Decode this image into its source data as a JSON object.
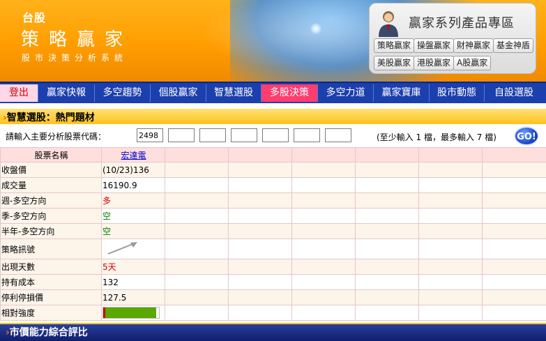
{
  "banner": {
    "tag": "台股",
    "title": "策略贏家",
    "subtitle": "股市決策分析系統",
    "promo_title": "贏家系列產品專區",
    "promo_buttons": [
      "策略贏家",
      "操盤贏家",
      "財神贏家",
      "基金神盾",
      "美股贏家",
      "港股贏家",
      "A股贏家"
    ]
  },
  "nav": {
    "items": [
      "登出",
      "贏家快報",
      "多空趨勢",
      "個股贏家",
      "智慧選股",
      "多股決策",
      "多空力道",
      "贏家寶庫",
      "股市動態",
      "自設選股"
    ],
    "active": "多股決策"
  },
  "section": {
    "title": "智慧選股：熱門題材"
  },
  "input": {
    "label": "請輸入主要分析股票代碼：",
    "codes": [
      "2498",
      "",
      "",
      "",
      "",
      "",
      ""
    ],
    "hint": "(至少輸入 1 檔，最多輸入 7 檔)",
    "go_label": "GO!"
  },
  "table": {
    "header_label": "股票名稱",
    "stock_name": "宏達電",
    "rows": [
      {
        "label": "收盤價",
        "value": "(10/23)136"
      },
      {
        "label": "成交量",
        "value": "16190.9"
      },
      {
        "label": "週-多空方向",
        "value": "多"
      },
      {
        "label": "季-多空方向",
        "value": "空"
      },
      {
        "label": "半年-多空方向",
        "value": "空"
      },
      {
        "label": "策略訊號",
        "value": ""
      },
      {
        "label": "出現天數",
        "value": "5天"
      },
      {
        "label": "持有成本",
        "value": "132"
      },
      {
        "label": "停利停損價",
        "value": "127.5"
      },
      {
        "label": "相對強度",
        "value": ""
      }
    ],
    "strength_fraction": 0.95
  },
  "bottom": {
    "title": "市價能力綜合評比"
  },
  "colors": {
    "accent": "#ff3d6f",
    "nav": "#1c3fae",
    "banner": "#ff9d00"
  }
}
